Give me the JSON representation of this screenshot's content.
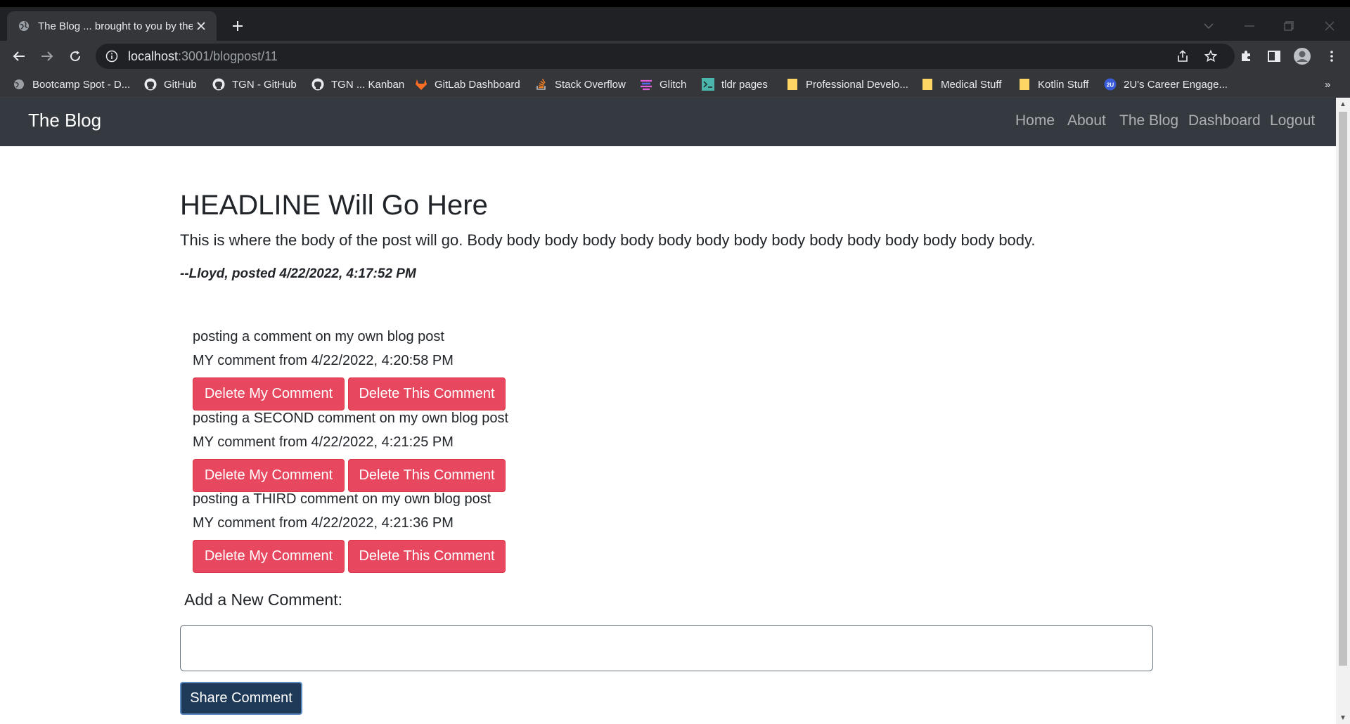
{
  "browser": {
    "tab_title": "The Blog ... brought to you by the",
    "url_host": "localhost",
    "url_rest": ":3001/blogpost/11",
    "bookmarks": [
      {
        "label": "Bootcamp Spot - D...",
        "icon": "globe-icon",
        "color": "#9aa0a6"
      },
      {
        "label": "GitHub",
        "icon": "github-icon",
        "color": "#e8eaed"
      },
      {
        "label": "TGN - GitHub",
        "icon": "github-icon",
        "color": "#e8eaed"
      },
      {
        "label": "TGN ... Kanban",
        "icon": "github-icon",
        "color": "#e8eaed"
      },
      {
        "label": "GitLab Dashboard",
        "icon": "gitlab-icon",
        "color": "#fc6d26"
      },
      {
        "label": "Stack Overflow",
        "icon": "stackoverflow-icon",
        "color": "#f48024"
      },
      {
        "label": "Glitch",
        "icon": "glitch-icon",
        "color": "#e25fdc"
      },
      {
        "label": "tldr pages",
        "icon": "tldr-icon",
        "color": "#4db6ac"
      },
      {
        "label": "Professional Develo...",
        "icon": "folder-icon",
        "color": "#fdd663"
      },
      {
        "label": "Medical Stuff",
        "icon": "folder-icon",
        "color": "#fdd663"
      },
      {
        "label": "Kotlin Stuff",
        "icon": "folder-icon",
        "color": "#fdd663"
      },
      {
        "label": "2U's Career Engage...",
        "icon": "2u-icon",
        "color": "#3a5bd9"
      }
    ],
    "more_bookmarks": "»"
  },
  "site": {
    "brand": "The Blog",
    "nav": [
      "Home",
      "About",
      "The Blog",
      "Dashboard",
      "Logout"
    ]
  },
  "post": {
    "headline": "HEADLINE Will Go Here",
    "body": "This is where the body of the post will go. Body body body body body body body body body body body body body body body.",
    "byline": "--Lloyd, posted 4/22/2022, 4:17:52 PM"
  },
  "comments": [
    {
      "text": "posting a comment on my own blog post",
      "meta": "MY comment from 4/22/2022, 4:20:58 PM",
      "delete_mine": "Delete My Comment",
      "delete_this": "Delete This Comment"
    },
    {
      "text": "posting a SECOND comment on my own blog post",
      "meta": "MY comment from 4/22/2022, 4:21:25 PM",
      "delete_mine": "Delete My Comment",
      "delete_this": "Delete This Comment"
    },
    {
      "text": "posting a THIRD comment on my own blog post",
      "meta": "MY comment from 4/22/2022, 4:21:36 PM",
      "delete_mine": "Delete My Comment",
      "delete_this": "Delete This Comment"
    }
  ],
  "new_comment": {
    "label": "Add a New Comment:",
    "value": "",
    "submit": "Share Comment"
  },
  "colors": {
    "navbar": "#343a40",
    "danger": "#e8485f",
    "share": "#1e3a58"
  }
}
